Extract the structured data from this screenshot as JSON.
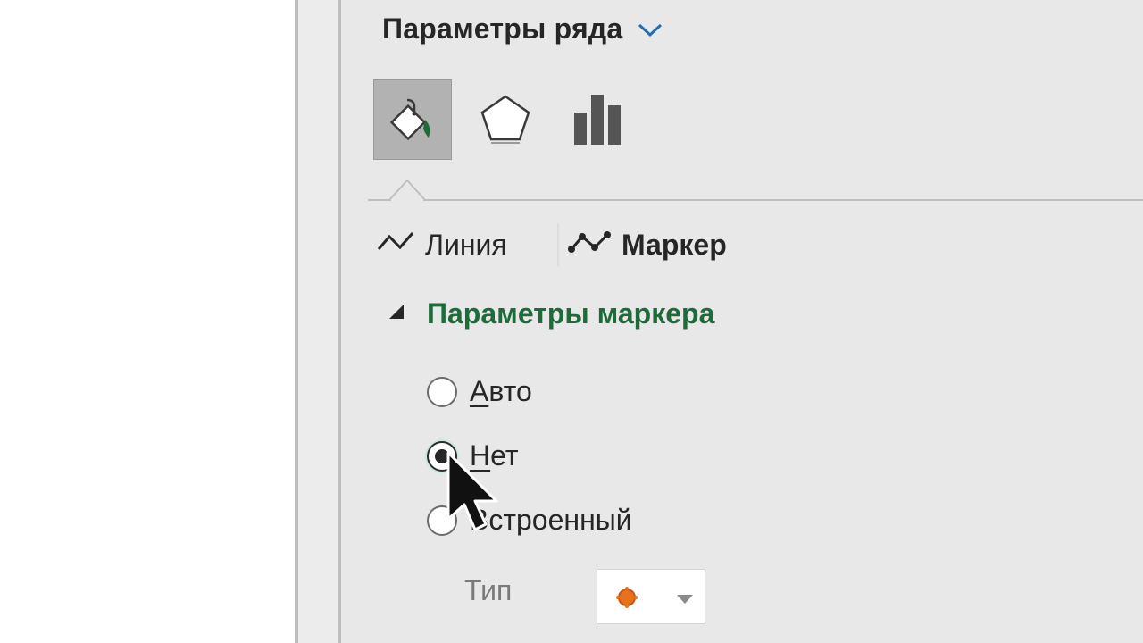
{
  "pane": {
    "title": "Параметры ряда",
    "category_tabs": [
      {
        "icon": "fill-bucket-icon",
        "selected": true
      },
      {
        "icon": "pentagon-icon",
        "selected": false
      },
      {
        "icon": "bar-chart-icon",
        "selected": false
      }
    ],
    "subtabs": [
      {
        "label": "Линия",
        "icon": "line-icon",
        "active": false
      },
      {
        "label": "Маркер",
        "icon": "marker-line-icon",
        "active": true
      }
    ],
    "section": {
      "title": "Параметры маркера",
      "options": [
        {
          "hotkey": "А",
          "rest": "вто",
          "checked": false
        },
        {
          "hotkey": "Н",
          "rest": "ет",
          "checked": true
        },
        {
          "hotkey": "",
          "rest": "Встроенный",
          "checked": false
        }
      ],
      "type_label": "Тип",
      "type_value_icon": "circle-marker-icon"
    }
  },
  "colors": {
    "accent_green": "#1e6b3a",
    "chevron_blue": "#1f6fb2",
    "marker_orange": "#e8721c"
  }
}
